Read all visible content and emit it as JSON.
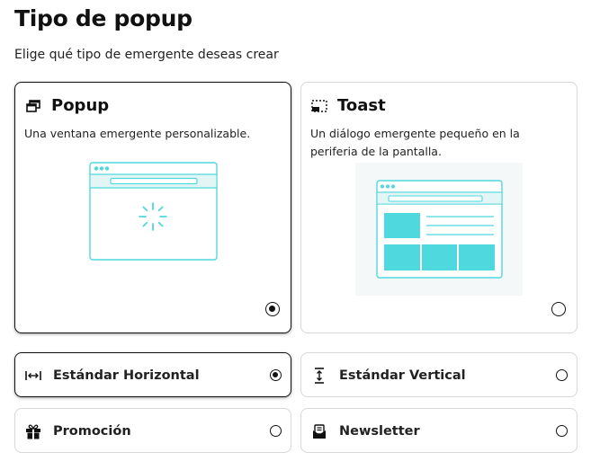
{
  "header": {
    "title": "Tipo de popup",
    "subtitle": "Elige qué tipo de emergente deseas crear"
  },
  "types": [
    {
      "name": "Popup",
      "description": "Una ventana emergente personalizable.",
      "icon": "popup-window-icon",
      "selected": true
    },
    {
      "name": "Toast",
      "description": "Un diálogo emergente pequeño en la periferia de la pantalla.",
      "icon": "toast-corner-icon",
      "selected": false
    }
  ],
  "layouts": [
    {
      "name": "Estándar Horizontal",
      "icon": "horizontal-arrows-icon",
      "selected": true
    },
    {
      "name": "Estándar Vertical",
      "icon": "vertical-arrows-icon",
      "selected": false
    },
    {
      "name": "Promoción",
      "icon": "gift-icon",
      "selected": false
    },
    {
      "name": "Newsletter",
      "icon": "mail-icon",
      "selected": false
    }
  ],
  "colors": {
    "accent": "#4fd8de",
    "accent_light": "#e3f6f5",
    "selected_border": "#111111",
    "unselected_border": "#d8d8d8"
  }
}
